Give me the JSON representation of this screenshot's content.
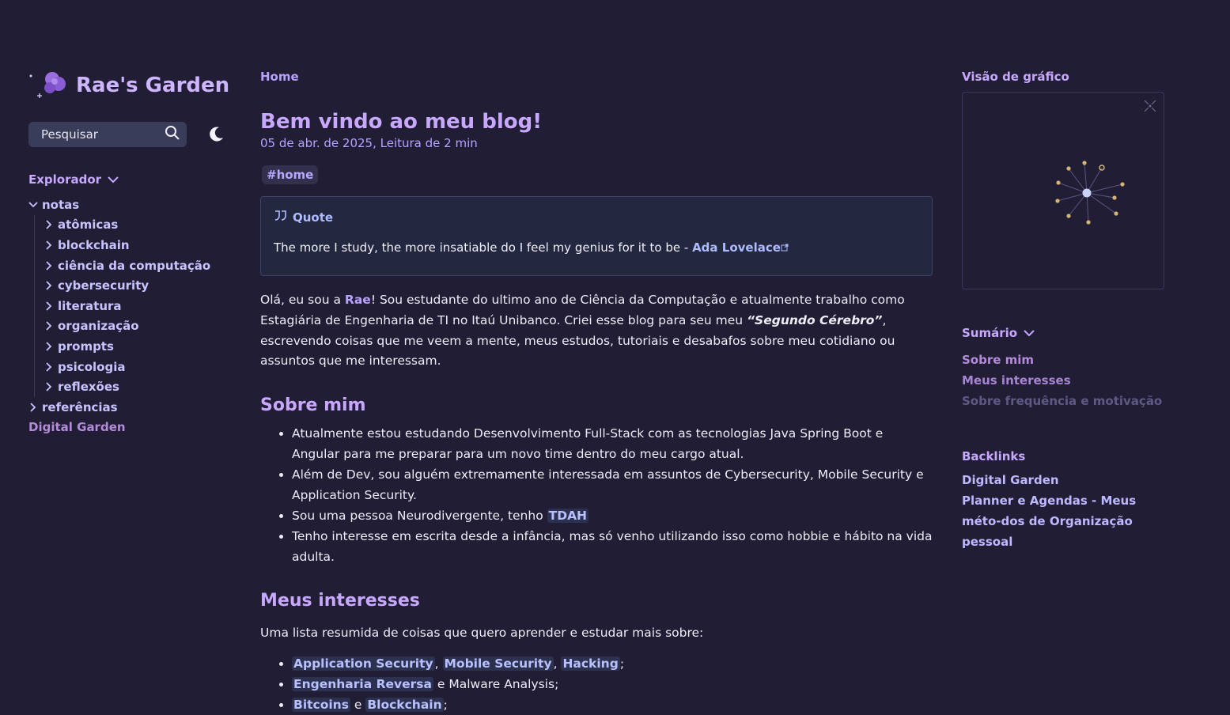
{
  "site": {
    "title": "Rae's Garden",
    "logo": "crystal-ball-icon"
  },
  "search": {
    "placeholder": "Pesquisar"
  },
  "explorer": {
    "title": "Explorador",
    "root": "notas",
    "children": [
      "atômicas",
      "blockchain",
      "ciência da computação",
      "cybersecurity",
      "literatura",
      "organização",
      "prompts",
      "psicologia",
      "reflexões"
    ],
    "after": "referências",
    "extra": "Digital Garden"
  },
  "breadcrumb": "Home",
  "post": {
    "title": "Bem vindo ao meu blog!",
    "meta": "05 de abr. de 2025,  Leitura de 2 min",
    "tag": "#home",
    "quote": {
      "label": "Quote",
      "text": "The more I study, the more insatiable do I feel my genius for it to be - ",
      "link": "Ada Lovelace"
    },
    "intro": {
      "part1": "Olá, eu sou a ",
      "name": "Rae",
      "part2": "! Sou estudante do ultimo ano de Ciência da Computação e atualmente trabalho como Estagiária de Engenharia de TI no Itaú Unibanco. Criei esse blog para seu meu ",
      "emph": "“Segundo Cérebro”",
      "part3": ", escrevendo coisas que me veem a mente, meus estudos, tutoriais e desabafos sobre meu cotidiano ou assuntos que me interessam."
    },
    "section1": {
      "title": "Sobre mim",
      "items": [
        "Atualmente estou estudando Desenvolvimento Full-Stack com as tecnologias Java Spring Boot e Angular para me preparar para um novo time dentro do meu cargo atual.",
        "Além de Dev, sou alguém extremamente interessada em assuntos de Cybersecurity, Mobile Security e Application Security."
      ],
      "item3_text": "Sou uma pessoa Neurodivergente, tenho ",
      "item3_link": "TDAH",
      "item4": "Tenho interesse em escrita desde a infância, mas só venho utilizando isso como hobbie e hábito na vida adulta."
    },
    "section2": {
      "title": "Meus interesses",
      "intro": "Uma lista resumida de coisas que quero aprender e estudar mais sobre:",
      "line1": {
        "a": "Application Security",
        "b": "Mobile Security",
        "c": "Hacking"
      },
      "line2": {
        "a": "Engenharia Reversa",
        "rest": " e Malware Analysis;"
      },
      "line3": {
        "a": "Bitcoins",
        "mid": " e ",
        "b": "Blockchain"
      }
    }
  },
  "graph": {
    "title": "Visão de gráfico"
  },
  "toc": {
    "title": "Sumário",
    "items": [
      "Sobre mim",
      "Meus interesses",
      "Sobre frequência e motivação"
    ]
  },
  "backlinks": {
    "title": "Backlinks",
    "items": [
      "Digital Garden",
      "Planner e Agendas - Meus méto-dos de Organização pessoal"
    ]
  }
}
